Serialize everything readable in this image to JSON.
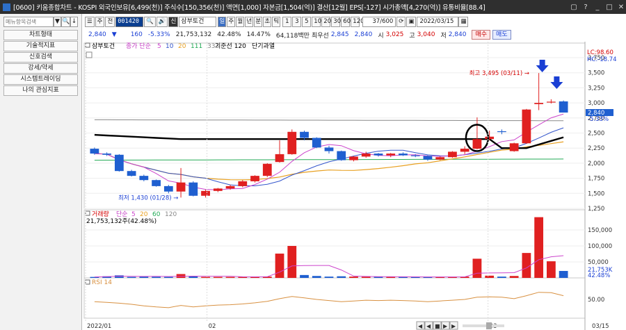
{
  "window": {
    "title": "[0600] 키움종합차트 - KOSPI 외국인보유[6,499(천)] 주식수[150,356(천)] 액면[1,000] 자본금[1,504(억)] 결산[12월] EPS[-127] 시가총액[4,270(억)] 유통비율[88.4]",
    "buttons": [
      "▢",
      "?",
      "_",
      "□",
      "✕"
    ]
  },
  "sidebar": {
    "search_placeholder": "메뉴항목검색",
    "search_btn": "▼",
    "find_btn": "🔍",
    "down_btn": "↓",
    "items": [
      "차트형태",
      "기술적지표",
      "신호검색",
      "강세/약세",
      "시스템트레이딩",
      "나의 관심지표"
    ]
  },
  "toolbar": {
    "menu_btn": "☰",
    "type": "주",
    "jeon": "전",
    "code": "001420",
    "search": "🔍",
    "sound": "🔊",
    "shin": "신",
    "stock_name": "삼부토건",
    "periods": [
      "일",
      "주",
      "월",
      "년",
      "분",
      "초",
      "틱"
    ],
    "nums": [
      "1",
      "3",
      "5",
      "10",
      "20",
      "30",
      "60",
      "120"
    ],
    "count": "37/600",
    "date": "2022/03/15"
  },
  "quote": {
    "price": "2,840",
    "change": "160",
    "rate": "-5.33%",
    "volume": "21,753,132",
    "vol_rate": "42.48%",
    "turnover": "14.47%",
    "amount": "64,118백만",
    "best_bid_label": "최우선",
    "best_bid": "2,845",
    "best_ask": "2,840",
    "open_label": "시",
    "open": "3,025",
    "high_label": "고",
    "high": "3,040",
    "low_label": "저",
    "low": "2,840",
    "buy": "매수",
    "sell": "매도"
  },
  "legend": {
    "stock": "삼부토건",
    "ma": "종가 단순",
    "ma_periods": [
      "5",
      "10",
      "20",
      "111",
      "333"
    ],
    "base_label": "기준선 120",
    "short_label": "단기과열"
  },
  "annotations": {
    "high_label": "최고 3,495 (03/11)",
    "low_label": "최저 1,430 (01/28)",
    "lc": "LC:98.60",
    "hc": "HC:-18.74",
    "price_tag": "2,840",
    "rate_tag": "-5.33%"
  },
  "volume_panel": {
    "title": "거래량",
    "ma": "단순",
    "ma_periods": [
      "5",
      "20",
      "60",
      "120"
    ],
    "value": "21,753,132주(42.48%)",
    "tag_vol": "21,753K",
    "tag_rate": "42.48%"
  },
  "rsi_panel": {
    "title": "RSI 14"
  },
  "xaxis": {
    "labels": [
      "2022/01",
      "02",
      "03",
      "03/15"
    ]
  },
  "colors": {
    "up": "#e02020",
    "down": "#1f5fd0",
    "ma5": "#cc44cc",
    "ma10": "#3355cc",
    "ma20": "#e8a020",
    "ma111": "#22aa55",
    "ma333": "#888888",
    "base": "#000000"
  },
  "chart_data": [
    {
      "type": "candlestick",
      "title": "삼부토건",
      "ylim": [
        1250,
        3900
      ],
      "y_ticks": [
        1250,
        1500,
        1750,
        2000,
        2250,
        2500,
        2750,
        3000,
        3250,
        3500,
        3750
      ],
      "candles": [
        {
          "o": 2240,
          "h": 2260,
          "l": 2140,
          "c": 2160
        },
        {
          "o": 2160,
          "h": 2180,
          "l": 2120,
          "c": 2140
        },
        {
          "o": 2140,
          "h": 2150,
          "l": 1860,
          "c": 1870
        },
        {
          "o": 1870,
          "h": 1890,
          "l": 1780,
          "c": 1790
        },
        {
          "o": 1790,
          "h": 1810,
          "l": 1700,
          "c": 1720
        },
        {
          "o": 1720,
          "h": 1730,
          "l": 1610,
          "c": 1620
        },
        {
          "o": 1620,
          "h": 1640,
          "l": 1500,
          "c": 1530
        },
        {
          "o": 1530,
          "h": 1920,
          "l": 1430,
          "c": 1680
        },
        {
          "o": 1680,
          "h": 1700,
          "l": 1450,
          "c": 1460
        },
        {
          "o": 1460,
          "h": 1560,
          "l": 1430,
          "c": 1540
        },
        {
          "o": 1540,
          "h": 1590,
          "l": 1520,
          "c": 1580
        },
        {
          "o": 1580,
          "h": 1640,
          "l": 1560,
          "c": 1620
        },
        {
          "o": 1620,
          "h": 1720,
          "l": 1600,
          "c": 1700
        },
        {
          "o": 1700,
          "h": 1800,
          "l": 1680,
          "c": 1790
        },
        {
          "o": 1790,
          "h": 2000,
          "l": 1770,
          "c": 1990
        },
        {
          "o": 2020,
          "h": 2380,
          "l": 2010,
          "c": 2150
        },
        {
          "o": 2150,
          "h": 2560,
          "l": 2140,
          "c": 2520
        },
        {
          "o": 2520,
          "h": 2540,
          "l": 2380,
          "c": 2420
        },
        {
          "o": 2420,
          "h": 2430,
          "l": 2250,
          "c": 2260
        },
        {
          "o": 2260,
          "h": 2290,
          "l": 2160,
          "c": 2200
        },
        {
          "o": 2200,
          "h": 2210,
          "l": 2040,
          "c": 2050
        },
        {
          "o": 2050,
          "h": 2120,
          "l": 2030,
          "c": 2110
        },
        {
          "o": 2110,
          "h": 2190,
          "l": 2090,
          "c": 2160
        },
        {
          "o": 2160,
          "h": 2170,
          "l": 2110,
          "c": 2130
        },
        {
          "o": 2130,
          "h": 2170,
          "l": 2100,
          "c": 2160
        },
        {
          "o": 2160,
          "h": 2180,
          "l": 2120,
          "c": 2130
        },
        {
          "o": 2130,
          "h": 2150,
          "l": 2100,
          "c": 2120
        },
        {
          "o": 2120,
          "h": 2130,
          "l": 2040,
          "c": 2060
        },
        {
          "o": 2060,
          "h": 2110,
          "l": 2050,
          "c": 2100
        },
        {
          "o": 2100,
          "h": 2200,
          "l": 2090,
          "c": 2190
        },
        {
          "o": 2190,
          "h": 2280,
          "l": 2150,
          "c": 2240
        },
        {
          "o": 2240,
          "h": 2760,
          "l": 2230,
          "c": 2400
        },
        {
          "o": 2400,
          "h": 2540,
          "l": 2380,
          "c": 2440
        },
        {
          "o": 2530,
          "h": 2560,
          "l": 2480,
          "c": 2520
        },
        {
          "o": 2200,
          "h": 2340,
          "l": 2190,
          "c": 2330
        },
        {
          "o": 2330,
          "h": 2900,
          "l": 2320,
          "c": 2890
        },
        {
          "o": 2980,
          "h": 3495,
          "l": 2880,
          "c": 3000
        },
        {
          "o": 3020,
          "h": 3060,
          "l": 2990,
          "c": 3020
        },
        {
          "o": 3025,
          "h": 3040,
          "l": 2840,
          "c": 2840
        }
      ]
    },
    {
      "type": "bar",
      "title": "거래량",
      "ylim": [
        0,
        200000
      ],
      "y_ticks": [
        50000,
        100000,
        150000
      ],
      "values": [
        3000,
        5000,
        8000,
        3000,
        4000,
        3500,
        3000,
        12000,
        5000,
        3000,
        3000,
        3000,
        3000,
        4000,
        4000,
        76000,
        100000,
        9000,
        6000,
        4000,
        5000,
        4000,
        3500,
        3500,
        3000,
        3000,
        3000,
        3000,
        3000,
        3500,
        4000,
        60000,
        7000,
        4000,
        6000,
        78000,
        190000,
        52000,
        21753
      ]
    },
    {
      "type": "line",
      "title": "RSI 14",
      "y_ticks": [
        50
      ],
      "values": [
        44,
        42,
        40,
        37,
        33,
        30,
        28,
        34,
        30,
        33,
        35,
        36,
        38,
        41,
        45,
        52,
        58,
        54,
        50,
        47,
        44,
        46,
        48,
        47,
        48,
        47,
        46,
        44,
        46,
        48,
        50,
        56,
        57,
        56,
        52,
        60,
        69,
        68,
        60
      ]
    }
  ]
}
